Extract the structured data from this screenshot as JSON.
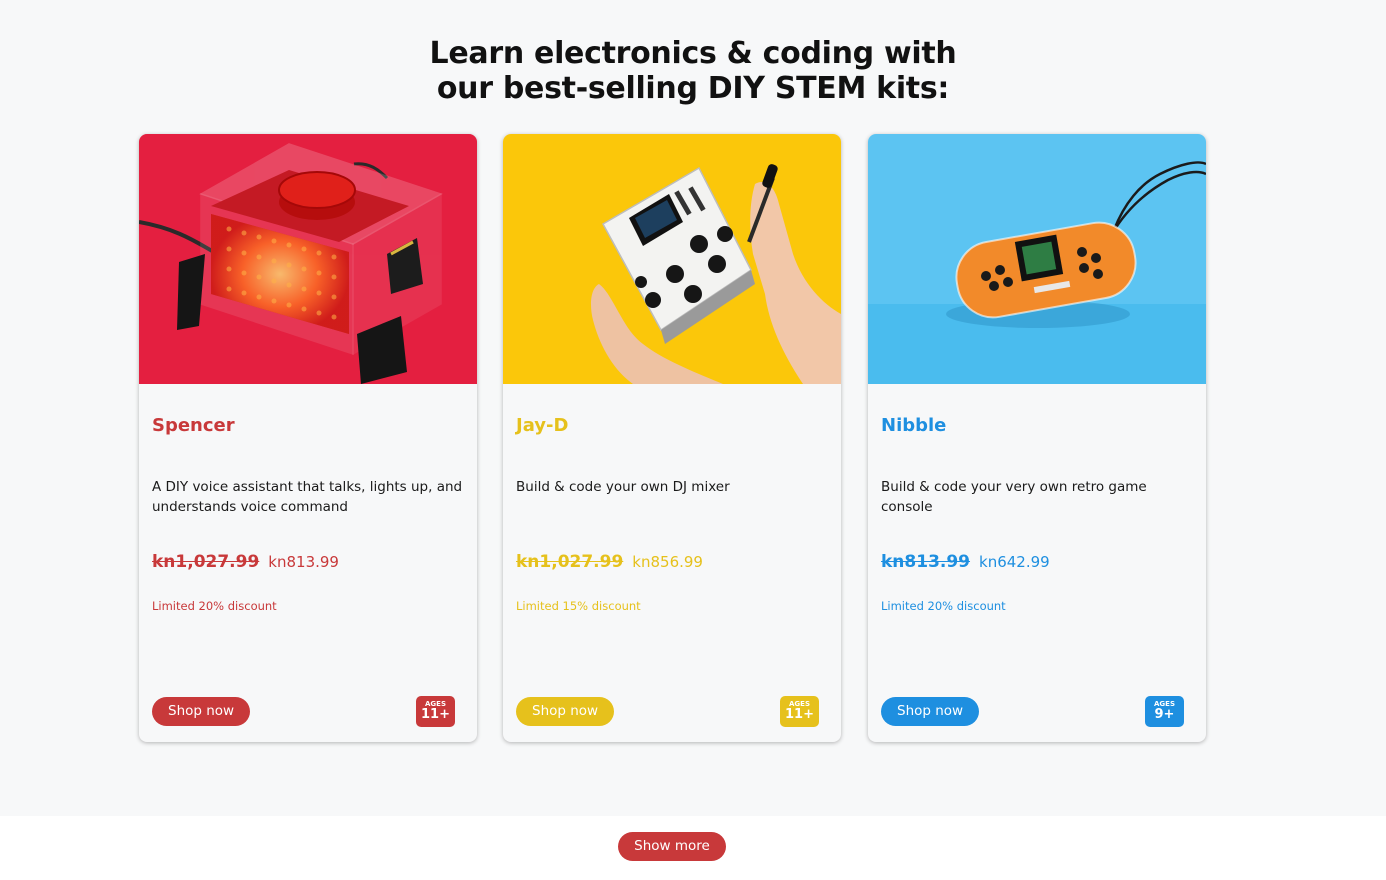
{
  "headline": {
    "line1": "Learn electronics & coding with",
    "line2": "our best-selling DIY STEM kits:"
  },
  "products": [
    {
      "name": "Spencer",
      "description": "A DIY voice assistant that talks, lights up, and understands voice command",
      "old_price": "kn1,027.99",
      "new_price": "kn813.99",
      "discount": "Limited 20% discount",
      "button": "Shop now",
      "ages_label": "AGES",
      "ages_value": "11+",
      "accent": "#c8393a",
      "image_bg": "#ec2242",
      "icon": "spencer-kit-image"
    },
    {
      "name": "Jay-D",
      "description": "Build & code your own DJ mixer",
      "old_price": "kn1,027.99",
      "new_price": "kn856.99",
      "discount": "Limited 15% discount",
      "button": "Shop now",
      "ages_label": "AGES",
      "ages_value": "11+",
      "accent": "#e6c11c",
      "image_bg": "#fbc70a",
      "icon": "jay-d-kit-image"
    },
    {
      "name": "Nibble",
      "description": "Build & code your very own retro game console",
      "old_price": "kn813.99",
      "new_price": "kn642.99",
      "discount": "Limited 20% discount",
      "button": "Shop now",
      "ages_label": "AGES",
      "ages_value": "9+",
      "accent": "#1e8fe0",
      "image_bg": "#5cc4f2",
      "icon": "nibble-kit-image"
    }
  ],
  "show_more": "Show more"
}
